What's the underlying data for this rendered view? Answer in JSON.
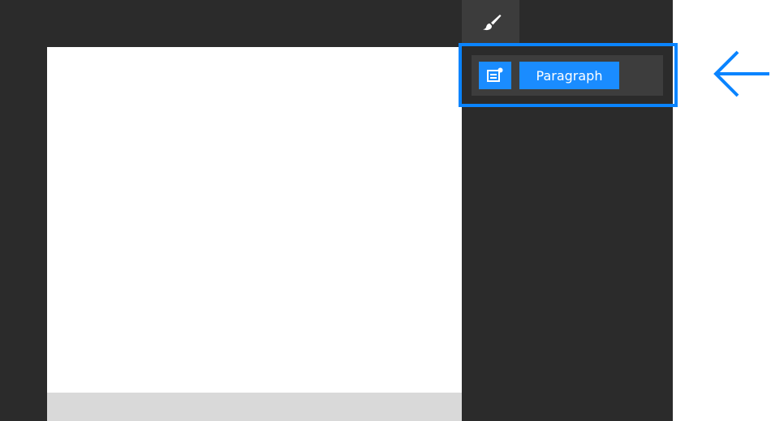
{
  "side_panel": {
    "tab": {
      "icon": "paintbrush-icon"
    },
    "style_row": {
      "icon": "paragraph-style-icon",
      "label": "Paragraph"
    }
  },
  "annotation": {
    "highlight_color": "#0a84ff",
    "arrow_icon": "left-arrow-icon"
  },
  "colors": {
    "workspace_bg": "#2b2b2b",
    "tab_bg": "#3c3c3c",
    "row_bg": "#3d3d3d",
    "accent": "#1a8cff",
    "canvas": "#ffffff",
    "canvas_footer": "#d9d9d9"
  }
}
